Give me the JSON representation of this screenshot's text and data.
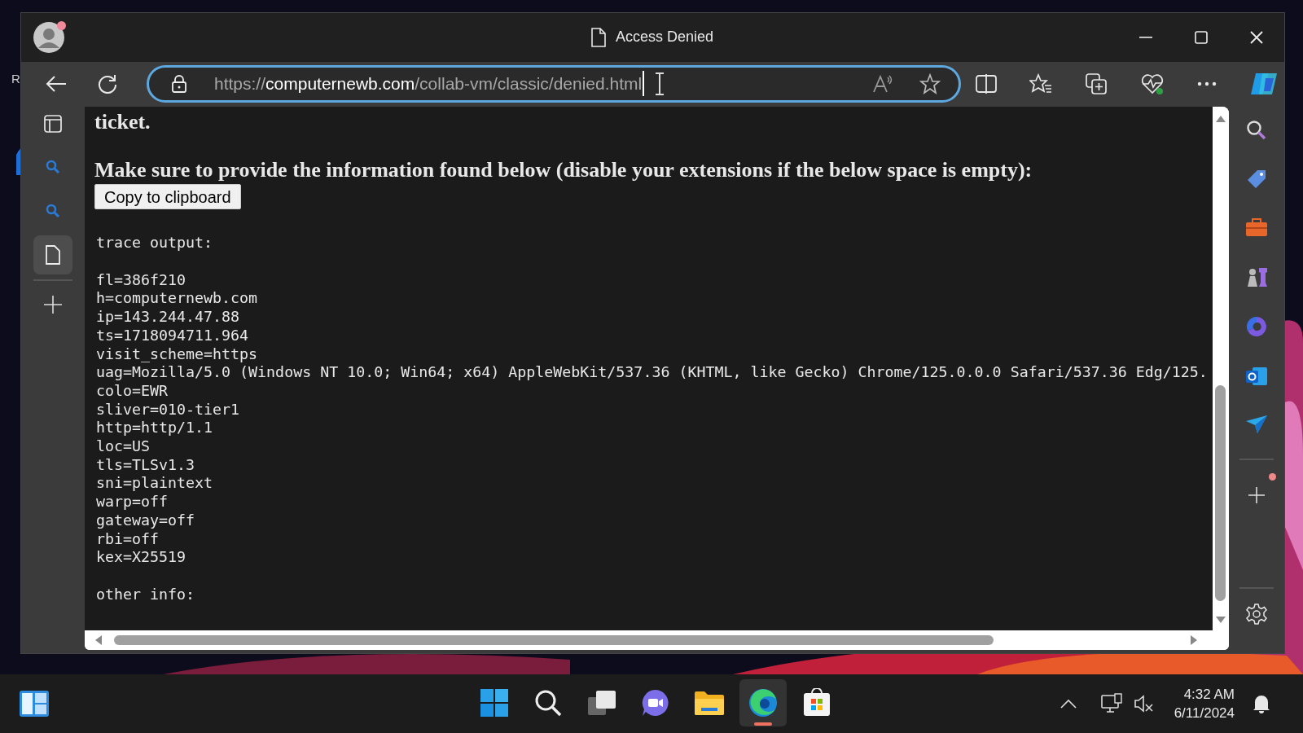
{
  "desktop": {
    "labels": [
      "R"
    ]
  },
  "window": {
    "title": "Access Denied"
  },
  "address_bar": {
    "scheme": "https://",
    "host": "computernewb.com",
    "path": "/collab-vm/classic/denied.html"
  },
  "vertical_tabs": [
    {
      "kind": "search",
      "selected": false
    },
    {
      "kind": "search",
      "selected": false
    },
    {
      "kind": "page",
      "selected": true
    }
  ],
  "page": {
    "ticket_text": "ticket.",
    "instruction": "Make sure to provide the information found below (disable your extensions if the below space is empty):",
    "copy_button": "Copy to clipboard",
    "trace_heading": "trace output:",
    "trace_lines": [
      "fl=386f210",
      "h=computernewb.com",
      "ip=143.244.47.88",
      "ts=1718094711.964",
      "visit_scheme=https",
      "uag=Mozilla/5.0 (Windows NT 10.0; Win64; x64) AppleWebKit/537.36 (KHTML, like Gecko) Chrome/125.0.0.0 Safari/537.36 Edg/125.",
      "colo=EWR",
      "sliver=010-tier1",
      "http=http/1.1",
      "loc=US",
      "tls=TLSv1.3",
      "sni=plaintext",
      "warp=off",
      "gateway=off",
      "rbi=off",
      "kex=X25519"
    ],
    "other_heading": "other info:"
  },
  "right_sidebar": [
    {
      "kind": "search"
    },
    {
      "kind": "tag"
    },
    {
      "kind": "toolbox"
    },
    {
      "kind": "chess"
    },
    {
      "kind": "copilot"
    },
    {
      "kind": "outlook"
    },
    {
      "kind": "send"
    }
  ],
  "taskbar": {
    "apps": [
      {
        "kind": "start",
        "selected": false
      },
      {
        "kind": "search",
        "selected": false
      },
      {
        "kind": "taskview",
        "selected": false
      },
      {
        "kind": "chat",
        "selected": false
      },
      {
        "kind": "folder",
        "selected": false
      },
      {
        "kind": "edge",
        "selected": true
      },
      {
        "kind": "store",
        "selected": false
      }
    ],
    "time": "4:32 AM",
    "date": "6/11/2024"
  }
}
